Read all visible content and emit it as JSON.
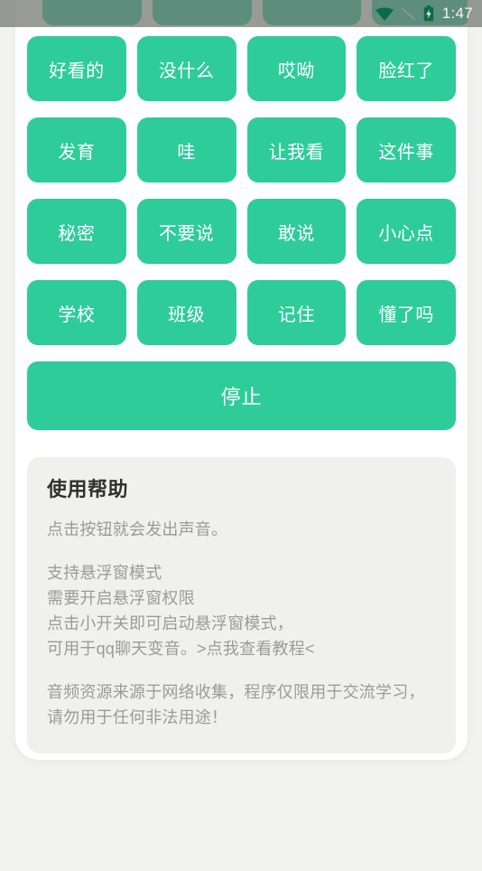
{
  "status_bar": {
    "time": "1:47",
    "icons": [
      "wifi-icon",
      "signal-off-icon",
      "battery-charging-icon"
    ]
  },
  "theme": {
    "accent_green": "#2ecc99",
    "sheet_white": "#ffffff",
    "page_background": "#f2f3f1",
    "card_background": "#f0f1ef",
    "button_text": "#ffffff",
    "help_title_color": "#303030",
    "help_body_color": "#9a9a9a",
    "status_bar_overlay": "rgba(112,116,112,0.72)"
  },
  "sound_grid": {
    "buttons": [
      {
        "label": "好看的"
      },
      {
        "label": "没什么"
      },
      {
        "label": "哎呦"
      },
      {
        "label": "脸红了"
      },
      {
        "label": "发育"
      },
      {
        "label": "哇"
      },
      {
        "label": "让我看"
      },
      {
        "label": "这件事"
      },
      {
        "label": "秘密"
      },
      {
        "label": "不要说"
      },
      {
        "label": "敢说"
      },
      {
        "label": "小心点"
      },
      {
        "label": "学校"
      },
      {
        "label": "班级"
      },
      {
        "label": "记住"
      },
      {
        "label": "懂了吗"
      }
    ]
  },
  "stop_button": {
    "label": "停止"
  },
  "help_card": {
    "title": "使用帮助",
    "paragraphs": [
      "点击按钮就会发出声音。",
      "支持悬浮窗模式\n需要开启悬浮窗权限\n点击小开关即可启动悬浮窗模式，\n可用于qq聊天变音。>点我查看教程<",
      "音频资源来源于网络收集，程序仅限用于交流学习，请勿用于任何非法用途！"
    ]
  }
}
